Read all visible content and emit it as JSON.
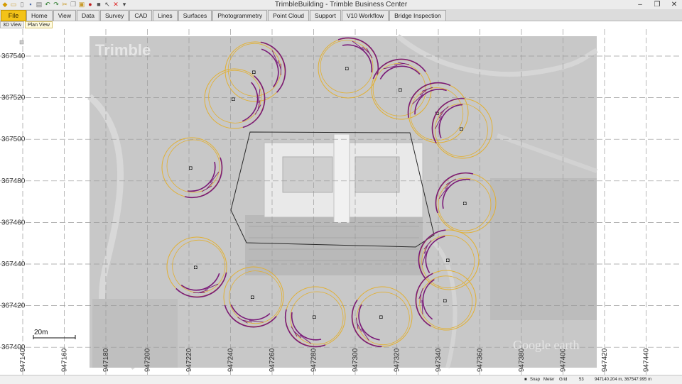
{
  "app": {
    "title": "TrimbleBuilding - Trimble Business Center",
    "file_label": "File"
  },
  "quick_access": [
    "app-icon",
    "folder-icon",
    "new-icon",
    "save-icon",
    "print-icon",
    "undo-icon",
    "redo-icon",
    "cut-icon",
    "copy-icon",
    "paste-icon",
    "record-icon",
    "stop-icon",
    "pointer-icon",
    "close-red-icon",
    "dropdown-icon"
  ],
  "window_controls": {
    "minimize": "–",
    "restore": "❐",
    "close": "✕"
  },
  "ribbon_tabs": [
    "Home",
    "View",
    "Data",
    "Survey",
    "CAD",
    "Lines",
    "Surfaces",
    "Photogrammetry",
    "Point Cloud",
    "Support",
    "V10 Workflow",
    "Bridge Inspection"
  ],
  "view_tabs": [
    {
      "label": "3D View",
      "active": false
    },
    {
      "label": "Plan View",
      "active": true
    }
  ],
  "map": {
    "watermark_brand": "Trimble",
    "watermark_source": "Google earth",
    "scale_bar_label": "20m",
    "y_tick_labels": [
      "367540",
      "367520",
      "367500",
      "367480",
      "367460",
      "367440",
      "367420",
      "367400"
    ],
    "x_tick_labels": [
      "947140",
      "947160",
      "947180",
      "947200",
      "947220",
      "947240",
      "947260",
      "947280",
      "947300",
      "947320",
      "947340",
      "947360",
      "947380",
      "947400",
      "947420",
      "947440"
    ],
    "colors": {
      "flight_path": "#7a1a78",
      "camera_circle": "#e2b032",
      "boundary": "#222222",
      "grid": "#9a9a9a"
    }
  },
  "status": {
    "snap": "Snap",
    "units": "Meter",
    "grid": "Grid",
    "zoom": "53",
    "coordinates": "947140.204 m, 367547.995 m"
  }
}
